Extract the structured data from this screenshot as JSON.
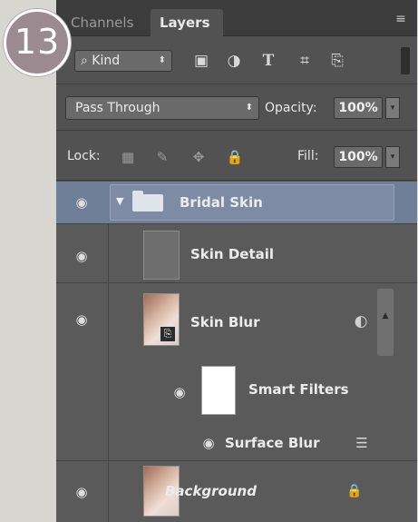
{
  "step_badge": "13",
  "tabs": {
    "channels": "Channels",
    "layers": "Layers"
  },
  "menu_icon": "≡",
  "filter": {
    "kind_label": "Kind",
    "search_glyph": "⌕",
    "arrows": "⬍",
    "icons": {
      "image": "▣",
      "adjustment": "◑",
      "type": "T",
      "shape": "⌗",
      "smart_object": "⎘"
    }
  },
  "blend": {
    "mode": "Pass Through",
    "arrows": "⬍",
    "opacity_label": "Opacity:",
    "opacity_value": "100%",
    "dropdown_arrow": "▾"
  },
  "lock": {
    "label": "Lock:",
    "icons": {
      "transparent": "▦",
      "pixels": "✎",
      "position": "✥",
      "all": "🔒"
    },
    "fill_label": "Fill:",
    "fill_value": "100%",
    "dropdown_arrow": "▾"
  },
  "layers": {
    "eye_glyph": "◉",
    "group": {
      "name": "Bridal Skin",
      "triangle": "▼"
    },
    "skin_detail": {
      "name": "Skin Detail"
    },
    "skin_blur": {
      "name": "Skin Blur",
      "smart_glyph": "⎘",
      "fx_glyph": "◐"
    },
    "scroll_up": "▲",
    "smart_filters": {
      "name": "Smart Filters"
    },
    "surface_blur": {
      "name": "Surface Blur",
      "settings_glyph": "☰"
    },
    "background": {
      "name": "Background",
      "lock_glyph": "🔒"
    }
  }
}
